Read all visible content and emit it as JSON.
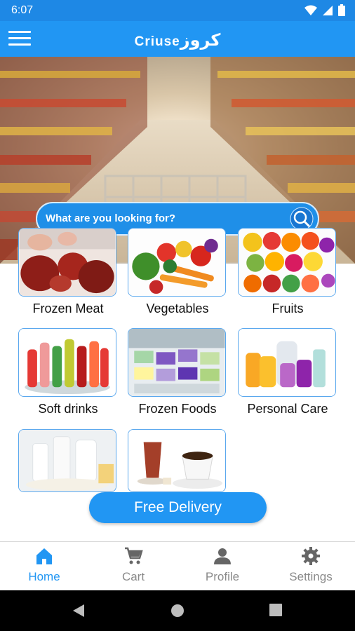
{
  "status_bar": {
    "time": "6:07"
  },
  "app_bar": {
    "title_latin": "Criuse",
    "title_arabic": "كروز"
  },
  "search": {
    "placeholder": "What are you looking for?"
  },
  "categories": [
    {
      "label": "Frozen Meat"
    },
    {
      "label": "Vegetables"
    },
    {
      "label": "Fruits"
    },
    {
      "label": "Soft drinks"
    },
    {
      "label": "Frozen Foods"
    },
    {
      "label": "Personal Care"
    },
    {
      "label": ""
    },
    {
      "label": ""
    }
  ],
  "free_delivery": {
    "label": "Free Delivery"
  },
  "bottom_nav": {
    "items": [
      {
        "label": "Home",
        "icon": "home-icon",
        "active": true
      },
      {
        "label": "Cart",
        "icon": "cart-icon",
        "active": false
      },
      {
        "label": "Profile",
        "icon": "person-icon",
        "active": false
      },
      {
        "label": "Settings",
        "icon": "gear-icon",
        "active": false
      }
    ]
  },
  "colors": {
    "primary": "#2196f3",
    "status_bar": "#1e88e5",
    "inactive": "#8a8a8a"
  }
}
